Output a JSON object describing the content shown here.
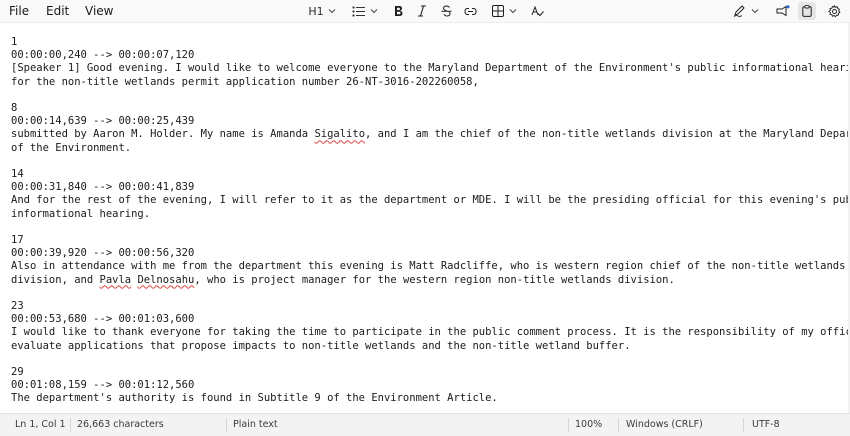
{
  "menu": {
    "file": "File",
    "edit": "Edit",
    "view": "View"
  },
  "toolbar": {
    "heading_label": "H1",
    "icons": [
      "list-icon",
      "bold-icon",
      "italic-icon",
      "strikethrough-icon",
      "link-icon",
      "table-icon",
      "clear-formatting-icon",
      "pen-icon",
      "share-icon",
      "clipboard-icon",
      "settings-icon"
    ]
  },
  "document": {
    "entries": [
      {
        "index": "1",
        "time": "00:00:00,240 --> 00:00:07,120",
        "line1": "[Speaker 1] Good evening. I would like to welcome everyone to the Maryland Department of the Environment's public informational hearing",
        "line2": "for the non-title wetlands permit application number 26-NT-3016-202260058,"
      },
      {
        "index": "8",
        "time": "00:00:14,639 --> 00:00:25,439",
        "line1_pre": "submitted by Aaron M. Holder. My name is Amanda ",
        "line1_flag": "Sigalito",
        "line1_post": ", and I am the chief of the non-title wetlands division at the Maryland Department",
        "line2": "of the Environment."
      },
      {
        "index": "14",
        "time": "00:00:31,840 --> 00:00:41,839",
        "line1": "And for the rest of the evening, I will refer to it as the department or MDE. I will be the presiding official for this evening's public",
        "line2": "informational hearing."
      },
      {
        "index": "17",
        "time": "00:00:39,920 --> 00:00:56,320",
        "line1": "Also in attendance with me from the department this evening is Matt Radcliffe, who is western region chief of the non-title wetlands",
        "line2_pre": "division, and ",
        "line2_flag1": "Pavla",
        "line2_mid": " ",
        "line2_flag2": "Delnosahu",
        "line2_post": ", who is project manager for the western region non-title wetlands division."
      },
      {
        "index": "23",
        "time": "00:00:53,680 --> 00:01:03,600",
        "line1": "I would like to thank everyone for taking the time to participate in the public comment process. It is the responsibility of my office to",
        "line2": "evaluate applications that propose impacts to non-title wetlands and the non-title wetland buffer."
      },
      {
        "index": "29",
        "time": "00:01:08,159 --> 00:01:12,560",
        "line1": "The department's authority is found in Subtitle 9 of the Environment Article."
      }
    ]
  },
  "status": {
    "position": "Ln 1, Col 1",
    "characters": "26,663 characters",
    "format": "Plain text",
    "zoom": "100%",
    "line_ending": "Windows (CRLF)",
    "encoding": "UTF-8"
  },
  "colors": {
    "spell_underline": "#e0473d",
    "toolbar_bg": "#f9f9f9",
    "statusbar_bg": "#f3f3f3"
  }
}
